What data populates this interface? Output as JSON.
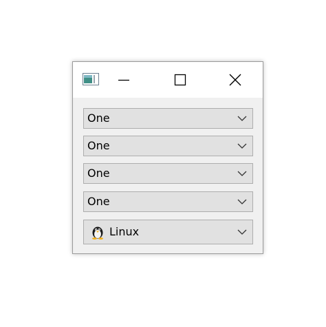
{
  "window": {
    "icon": "app-window-icon",
    "controls": {
      "minimize_icon": "minimize-icon",
      "maximize_icon": "maximize-icon",
      "close_icon": "close-icon"
    }
  },
  "combos": [
    {
      "value": "One",
      "icon": "chevron-down-icon"
    },
    {
      "value": "One",
      "icon": "chevron-down-icon"
    },
    {
      "value": "One",
      "icon": "chevron-down-icon"
    },
    {
      "value": "One",
      "icon": "chevron-down-icon"
    },
    {
      "value": "Linux",
      "item_icon": "tux-penguin-icon",
      "icon": "chevron-down-icon"
    }
  ],
  "colors": {
    "titlebar": "#ffffff",
    "client": "#f0f0f0",
    "combo_bg": "#e1e1e1",
    "combo_border": "#adadad"
  }
}
